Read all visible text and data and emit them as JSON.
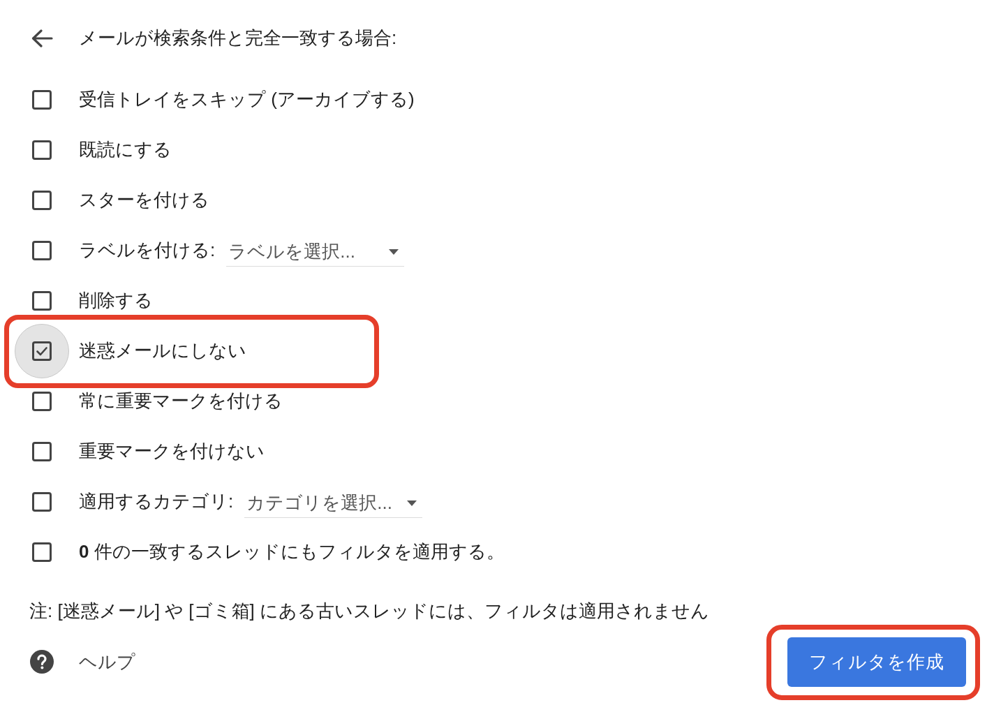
{
  "header": {
    "title": "メールが検索条件と完全一致する場合:"
  },
  "actions": [
    {
      "kind": "checkbox",
      "label": "受信トレイをスキップ (アーカイブする)",
      "checked": false,
      "focused": false,
      "highlighted": false
    },
    {
      "kind": "checkbox",
      "label": "既読にする",
      "checked": false,
      "focused": false,
      "highlighted": false
    },
    {
      "kind": "checkbox",
      "label": "スターを付ける",
      "checked": false,
      "focused": false,
      "highlighted": false
    },
    {
      "kind": "select",
      "label": "ラベルを付ける:",
      "value": "ラベルを選択...",
      "checked": false,
      "focused": false,
      "highlighted": false
    },
    {
      "kind": "checkbox",
      "label": "削除する",
      "checked": false,
      "focused": false,
      "highlighted": false
    },
    {
      "kind": "checkbox",
      "label": "迷惑メールにしない",
      "checked": true,
      "focused": true,
      "highlighted": true
    },
    {
      "kind": "checkbox",
      "label": "常に重要マークを付ける",
      "checked": false,
      "focused": false,
      "highlighted": false
    },
    {
      "kind": "checkbox",
      "label": "重要マークを付けない",
      "checked": false,
      "focused": false,
      "highlighted": false
    },
    {
      "kind": "select",
      "label": "適用するカテゴリ:",
      "value": "カテゴリを選択...",
      "checked": false,
      "focused": false,
      "highlighted": false
    },
    {
      "kind": "checkbox",
      "label": "**0** 件の一致するスレッドにもフィルタを適用する。",
      "checked": false,
      "focused": false,
      "highlighted": false
    }
  ],
  "note": "注: [迷惑メール] や [ゴミ箱] にある古いスレッドには、フィルタは適用されません",
  "help": {
    "label": "ヘルプ"
  },
  "create_button": {
    "label": "フィルタを作成",
    "highlighted": true
  }
}
